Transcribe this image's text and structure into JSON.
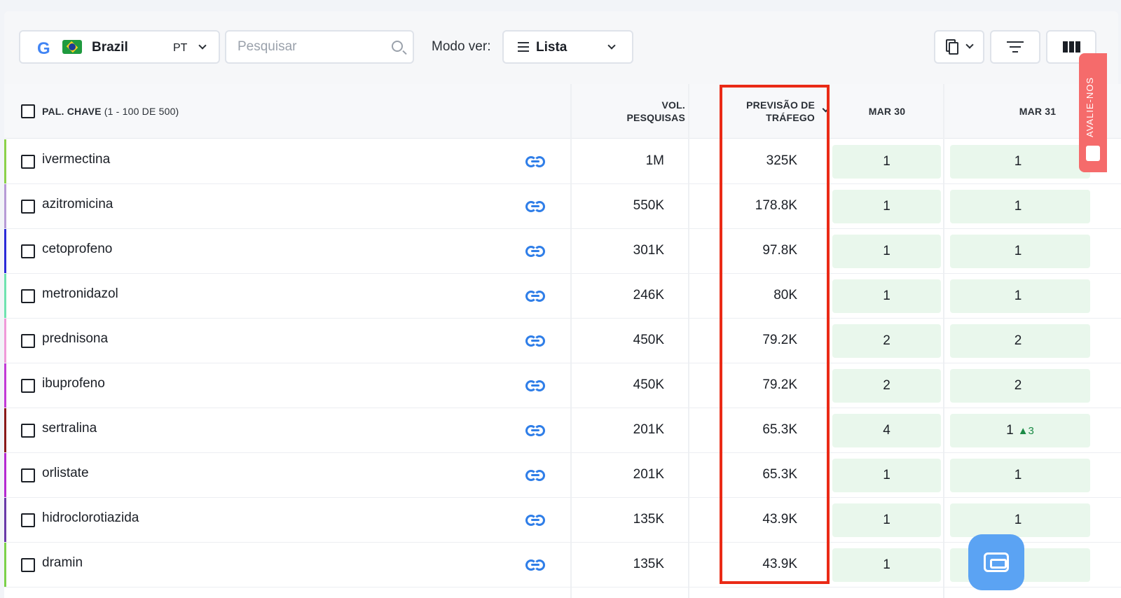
{
  "toolbar": {
    "region": {
      "engine_logo": "G",
      "flag": "brazil-flag-icon",
      "country": "Brazil",
      "language": "PT"
    },
    "search": {
      "placeholder": "Pesquisar",
      "value": ""
    },
    "view_mode_label": "Modo ver:",
    "view_mode_value": "Lista",
    "icons": {
      "copy": "copy-icon",
      "filter": "filter-icon",
      "columns": "columns-icon"
    }
  },
  "table": {
    "headers": {
      "keyword": "PAL. CHAVE",
      "keyword_count": "(1 - 100 DE 500)",
      "volume_line1": "VOL.",
      "volume_line2": "PESQUISAS",
      "traffic_line1": "PREVISÃO DE",
      "traffic_line2": "TRÁFEGO",
      "date1": "MAR 30",
      "date2": "MAR 31"
    },
    "rows": [
      {
        "keyword": "ivermectina",
        "color": "#8cd14a",
        "volume": "1M",
        "traffic": "325K",
        "pos1": "1",
        "pos2": "1",
        "delta": ""
      },
      {
        "keyword": "azitromicina",
        "color": "#b79bd6",
        "volume": "550K",
        "traffic": "178.8K",
        "pos1": "1",
        "pos2": "1",
        "delta": ""
      },
      {
        "keyword": "cetoprofeno",
        "color": "#2a2ad8",
        "volume": "301K",
        "traffic": "97.8K",
        "pos1": "1",
        "pos2": "1",
        "delta": ""
      },
      {
        "keyword": "metronidazol",
        "color": "#6fe3b0",
        "volume": "246K",
        "traffic": "80K",
        "pos1": "1",
        "pos2": "1",
        "delta": ""
      },
      {
        "keyword": "prednisona",
        "color": "#f09ad9",
        "volume": "450K",
        "traffic": "79.2K",
        "pos1": "2",
        "pos2": "2",
        "delta": ""
      },
      {
        "keyword": "ibuprofeno",
        "color": "#c23ad6",
        "volume": "450K",
        "traffic": "79.2K",
        "pos1": "2",
        "pos2": "2",
        "delta": ""
      },
      {
        "keyword": "sertralina",
        "color": "#8a1a1a",
        "volume": "201K",
        "traffic": "65.3K",
        "pos1": "4",
        "pos2": "1",
        "delta": "▲3"
      },
      {
        "keyword": "orlistate",
        "color": "#b52ad1",
        "volume": "201K",
        "traffic": "65.3K",
        "pos1": "1",
        "pos2": "1",
        "delta": ""
      },
      {
        "keyword": "hidroclorotiazida",
        "color": "#6a3aa8",
        "volume": "135K",
        "traffic": "43.9K",
        "pos1": "1",
        "pos2": "1",
        "delta": ""
      },
      {
        "keyword": "dramin",
        "color": "#7cd14a",
        "volume": "135K",
        "traffic": "43.9K",
        "pos1": "1",
        "pos2": "",
        "delta": ""
      }
    ]
  },
  "feedback_tab": {
    "label": "AVALIE-NOS"
  },
  "chat": {
    "icon": "chat-icon"
  }
}
